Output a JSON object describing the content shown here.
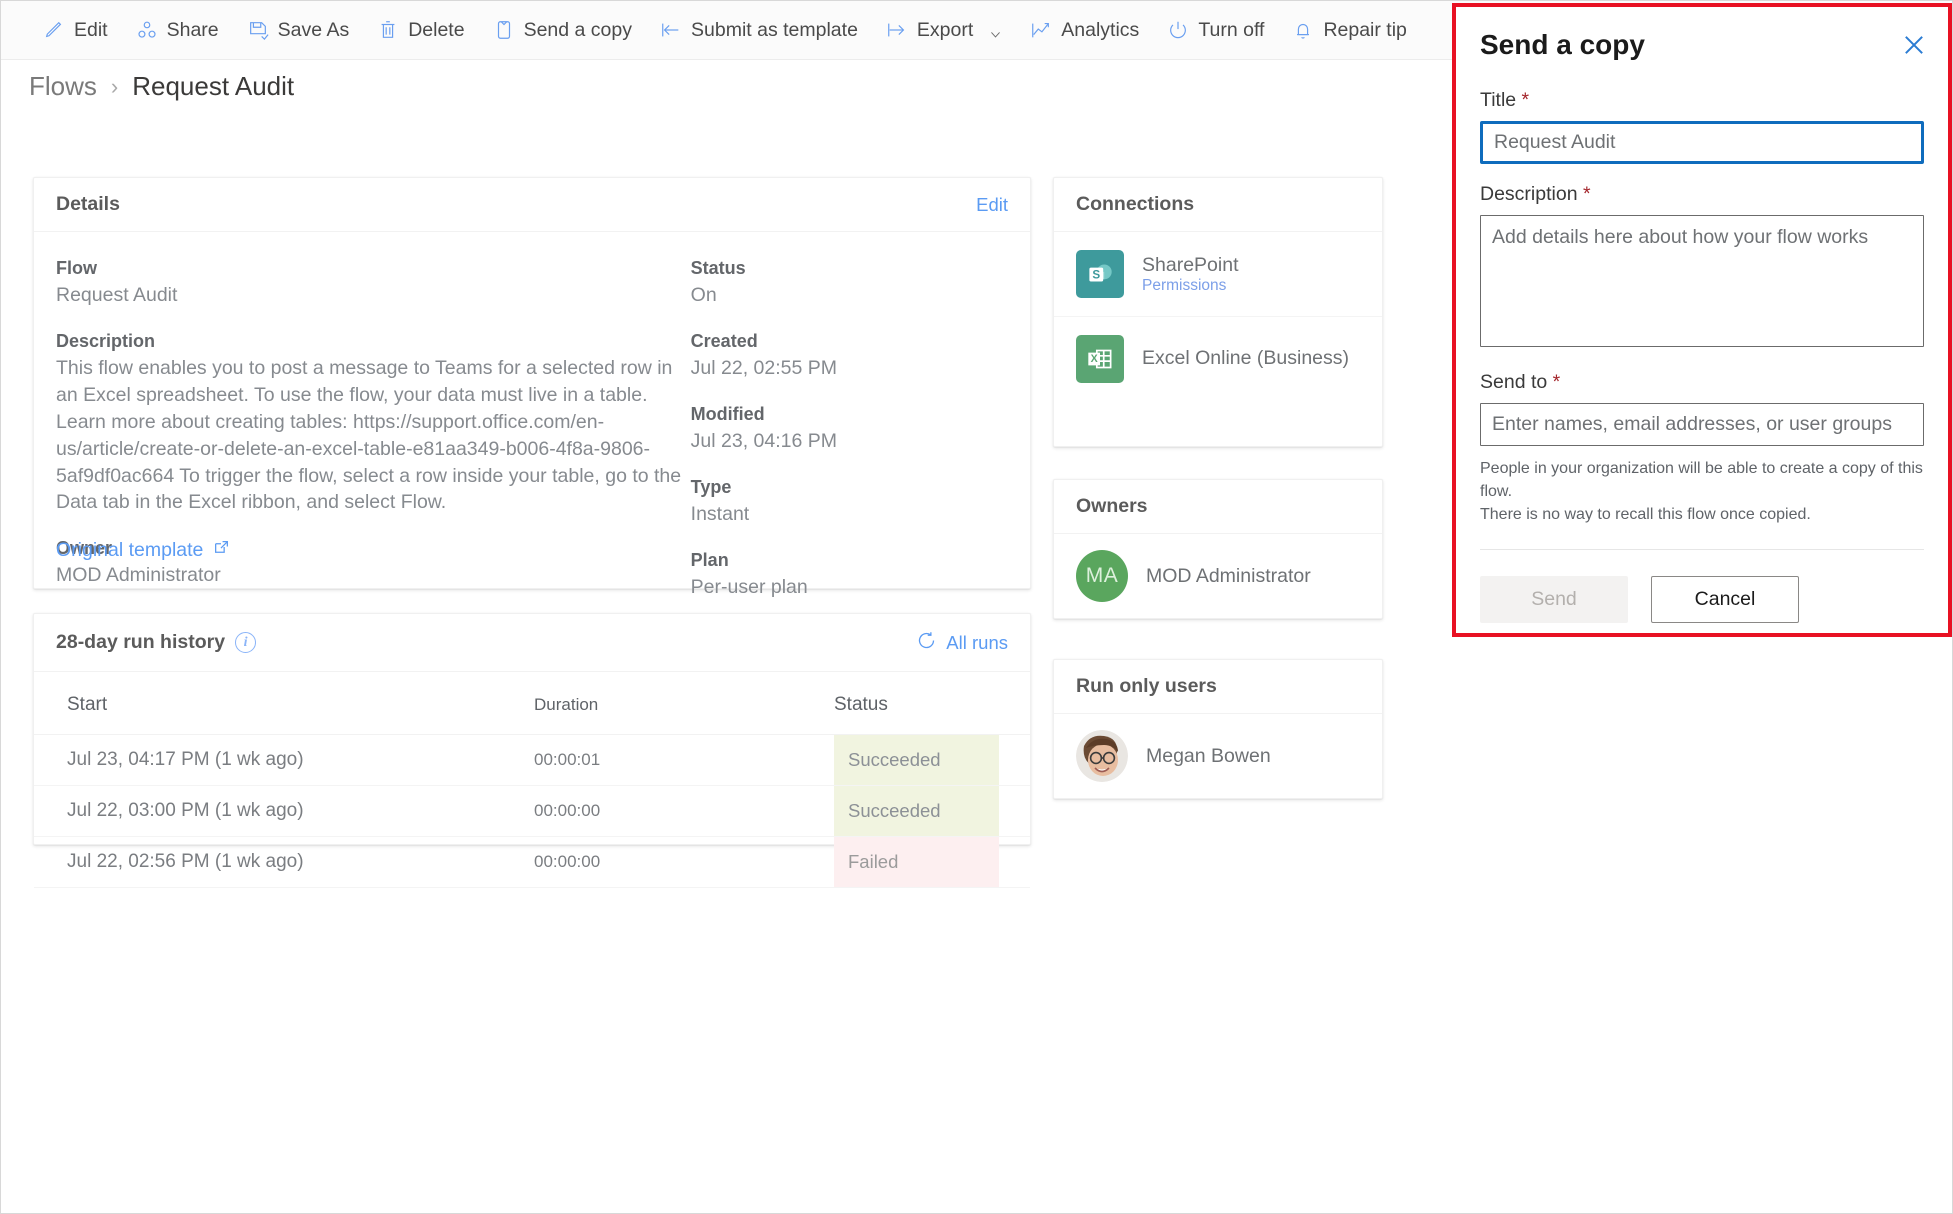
{
  "command_bar": {
    "items": [
      {
        "label": "Edit",
        "icon": "pencil-icon"
      },
      {
        "label": "Share",
        "icon": "share-icon"
      },
      {
        "label": "Save As",
        "icon": "save-as-icon"
      },
      {
        "label": "Delete",
        "icon": "trash-icon"
      },
      {
        "label": "Send a copy",
        "icon": "send-a-copy-icon"
      },
      {
        "label": "Submit as template",
        "icon": "submit-as-template-icon"
      },
      {
        "label": "Export",
        "icon": "export-icon",
        "has_caret": true
      },
      {
        "label": "Analytics",
        "icon": "analytics-icon"
      },
      {
        "label": "Turn off",
        "icon": "power-icon"
      },
      {
        "label": "Repair tip",
        "icon": "bell-icon"
      }
    ]
  },
  "breadcrumb": {
    "parent": "Flows",
    "separator": "›",
    "current": "Request Audit"
  },
  "details": {
    "title": "Details",
    "edit_label": "Edit",
    "left": [
      {
        "label": "Flow",
        "value": "Request Audit"
      },
      {
        "label": "Description",
        "value": "This flow enables you to post a message to Teams for a selected row in an Excel spreadsheet. To use the flow, your data must live in a table. Learn more about creating tables: https://support.office.com/en-us/article/create-or-delete-an-excel-table-e81aa349-b006-4f8a-9806-5af9df0ac664 To trigger the flow, select a row inside your table, go to the Data tab in the Excel ribbon, and select Flow."
      },
      {
        "label": "Owner",
        "value": "MOD Administrator"
      }
    ],
    "right": [
      {
        "label": "Status",
        "value": "On"
      },
      {
        "label": "Created",
        "value": "Jul 22, 02:55 PM"
      },
      {
        "label": "Modified",
        "value": "Jul 23, 04:16 PM"
      },
      {
        "label": "Type",
        "value": "Instant"
      },
      {
        "label": "Plan",
        "value": "Per-user plan"
      }
    ],
    "original_template_label": "Original template"
  },
  "run_history": {
    "title": "28-day run history",
    "info_glyph": "i",
    "all_runs_label": "All runs",
    "columns": [
      "Start",
      "Duration",
      "Status"
    ],
    "rows": [
      {
        "start": "Jul 23, 04:17 PM (1 wk ago)",
        "duration": "00:00:01",
        "status": "Succeeded",
        "status_kind": "succeeded"
      },
      {
        "start": "Jul 22, 03:00 PM (1 wk ago)",
        "duration": "00:00:00",
        "status": "Succeeded",
        "status_kind": "succeeded"
      },
      {
        "start": "Jul 22, 02:56 PM (1 wk ago)",
        "duration": "00:00:00",
        "status": "Failed",
        "status_kind": "failed"
      }
    ]
  },
  "connections": {
    "title": "Connections",
    "items": [
      {
        "name": "SharePoint",
        "sub": "Permissions",
        "icon": "sharepoint-icon",
        "color": "#3e9a9c"
      },
      {
        "name": "Excel Online (Business)",
        "sub": "",
        "icon": "excel-icon",
        "color": "#5aa573"
      }
    ]
  },
  "owners": {
    "title": "Owners",
    "items": [
      {
        "name": "MOD Administrator",
        "initials": "MA",
        "avatar_color": "#5aa65e"
      }
    ]
  },
  "run_only_users": {
    "title": "Run only users",
    "items": [
      {
        "name": "Megan Bowen",
        "avatar": "photo"
      }
    ]
  },
  "send_copy_dialog": {
    "title": "Send a copy",
    "close_icon": "close-icon",
    "title_field": {
      "label": "Title",
      "required": "*",
      "value": "Request Audit"
    },
    "description_field": {
      "label": "Description",
      "required": "*",
      "value": "",
      "placeholder": "Add details here about how your flow works"
    },
    "send_to_field": {
      "label": "Send to",
      "required": "*",
      "value": "",
      "placeholder": "Enter names, email addresses, or user groups"
    },
    "note_line_1": "People in your organization will be able to create a copy of this flow.",
    "note_line_2": "There is no way to recall this flow once copied.",
    "send_label": "Send",
    "cancel_label": "Cancel"
  },
  "colors": {
    "accent_link": "#5b9bf3",
    "dialog_outline": "#e81123",
    "focus_border": "#0f6cbd",
    "required_star": "#a4262c",
    "status_succeeded_bg": "#f1f4e0",
    "status_failed_bg": "#fdeff0"
  }
}
